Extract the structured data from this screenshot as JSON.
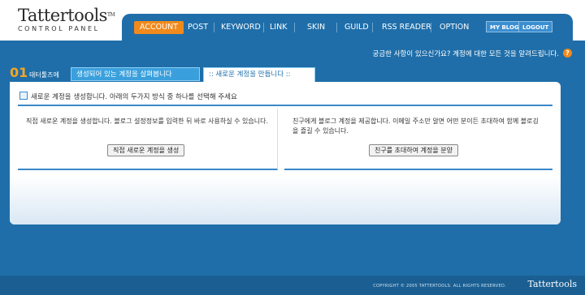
{
  "logo": {
    "title": "Tattertools",
    "tm": "TM",
    "subtitle": "CONTROL PANEL"
  },
  "nav": {
    "items": [
      "ACCOUNT",
      "POST",
      "KEYWORD",
      "LINK",
      "SKIN",
      "GUILD",
      "RSS READER",
      "OPTION"
    ],
    "active": "ACCOUNT",
    "my_blog": "MY BLOG",
    "logout": "LOGOUT"
  },
  "help": {
    "text": "궁금한 사항이 있으신가요? 계정에 대한 모든 것을 알려드립니다.",
    "icon": "question-icon"
  },
  "tabs": {
    "step_number": "01",
    "step_label": "태터툴즈에",
    "tab1": "생성되어 있는 계정을 살펴봅니다",
    "tab2": ":: 새로운 계정을 만듭니다 ::"
  },
  "main": {
    "notice": "새로운 계정을 생성합니다. 아래의 두가지 방식 중 하나를 선택해 주세요",
    "left_text": "직접 새로운 계정을 생성합니다. 블로그 설정정보를 입력한 뒤 바로 사용하실 수 있습니다.",
    "left_button": "직접 새로운 계정을 생성",
    "right_text": "친구에게 블로그 계정을 제공합니다. 이메일 주소만 알면 어떤 분이든 초대하여 함께 블로깅을 즐길 수 있습니다.",
    "right_button": "친구를 초대하여 계정을 분양"
  },
  "footer": {
    "copyright": "COPYRIGHT © 2005 TATTERTOOLS. ALL RIGHTS RESERVED.",
    "logo": "Tattertools"
  },
  "colors": {
    "brand_blue": "#1f6ea9",
    "accent_orange": "#f08a1c",
    "tab_blue": "#3aa0dd"
  }
}
